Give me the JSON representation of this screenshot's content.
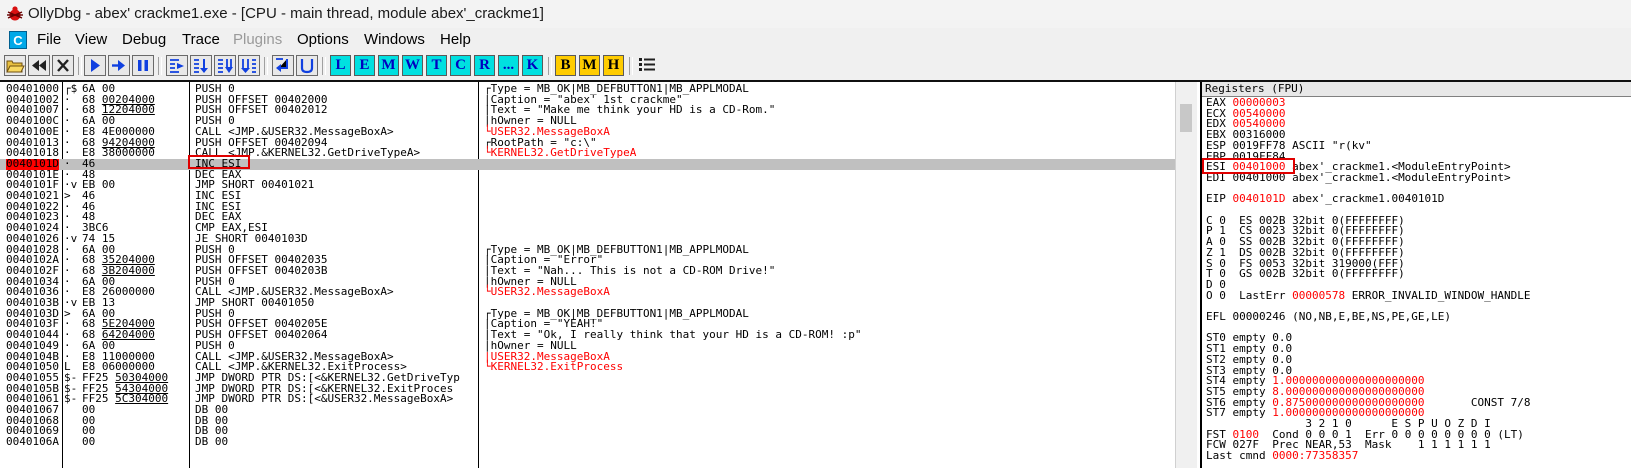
{
  "window": {
    "title": "OllyDbg - abex' crackme1.exe - [CPU - main thread, module abex'_crackme1]",
    "icon": "ollydbg-bug-icon"
  },
  "menu": {
    "logo": "C",
    "items": [
      "File",
      "View",
      "Debug",
      "Trace",
      "Plugins",
      "Options",
      "Windows",
      "Help"
    ]
  },
  "toolbar": {
    "letters": [
      "L",
      "E",
      "M",
      "W",
      "T",
      "C",
      "R",
      "...",
      "K",
      "B",
      "M",
      "H"
    ]
  },
  "code": {
    "rows": [
      {
        "addr": "00401000",
        "mark": "┌$",
        "hex": "6A 00",
        "hexu": "",
        "asm": "PUSH 0",
        "cmt": "┌Type = MB_OK|MB_DEFBUTTON1|MB_APPLMODAL",
        "cc": "black"
      },
      {
        "addr": "00401002",
        "mark": "·",
        "hex": "68 ",
        "hexu": "00204000",
        "asm": "PUSH OFFSET 00402000",
        "cmt": "|Caption = \"abex' 1st crackme\"",
        "cc": "black"
      },
      {
        "addr": "00401007",
        "mark": "·",
        "hex": "68 ",
        "hexu": "12204000",
        "asm": "PUSH OFFSET 00402012",
        "cmt": "|Text = \"Make me think your HD is a CD-Rom.\"",
        "cc": "black"
      },
      {
        "addr": "0040100C",
        "mark": "·",
        "hex": "6A 00",
        "hexu": "",
        "asm": "PUSH 0",
        "cmt": "|hOwner = NULL",
        "cc": "black"
      },
      {
        "addr": "0040100E",
        "mark": "·",
        "hex": "E8 4E000000",
        "hexu": "",
        "asm": "CALL <JMP.&USER32.MessageBoxA>",
        "cmt": "└USER32.MessageBoxA",
        "cc": "red"
      },
      {
        "addr": "00401013",
        "mark": "·",
        "hex": "68 ",
        "hexu": "94204000",
        "asm": "PUSH OFFSET 00402094",
        "cmt": "┌RootPath = \"c:\\\"",
        "cc": "black"
      },
      {
        "addr": "00401018",
        "mark": "·",
        "hex": "E8 38000000",
        "hexu": "",
        "asm": "CALL <JMP.&KERNEL32.GetDriveTypeA>",
        "cmt": "└KERNEL32.GetDriveTypeA",
        "cc": "red"
      },
      {
        "addr": "0040101D",
        "mark": "·",
        "hex": "46",
        "hexu": "",
        "asm": "INC ESI",
        "cmt": "",
        "cc": "black",
        "sel": true
      },
      {
        "addr": "0040101E",
        "mark": "·",
        "hex": "48",
        "hexu": "",
        "asm": "DEC EAX",
        "cmt": "",
        "cc": "black"
      },
      {
        "addr": "0040101F",
        "mark": "·v",
        "hex": "EB 00",
        "hexu": "",
        "asm": "JMP SHORT 00401021",
        "cmt": "",
        "cc": "black"
      },
      {
        "addr": "00401021",
        "mark": ">",
        "hex": "46",
        "hexu": "",
        "asm": "INC ESI",
        "cmt": "",
        "cc": "black"
      },
      {
        "addr": "00401022",
        "mark": "·",
        "hex": "46",
        "hexu": "",
        "asm": "INC ESI",
        "cmt": "",
        "cc": "black"
      },
      {
        "addr": "00401023",
        "mark": "·",
        "hex": "48",
        "hexu": "",
        "asm": "DEC EAX",
        "cmt": "",
        "cc": "black"
      },
      {
        "addr": "00401024",
        "mark": "·",
        "hex": "3BC6",
        "hexu": "",
        "asm": "CMP EAX,ESI",
        "cmt": "",
        "cc": "black"
      },
      {
        "addr": "00401026",
        "mark": "·v",
        "hex": "74 15",
        "hexu": "",
        "asm": "JE SHORT 0040103D",
        "cmt": "",
        "cc": "black"
      },
      {
        "addr": "00401028",
        "mark": "·",
        "hex": "6A 00",
        "hexu": "",
        "asm": "PUSH 0",
        "cmt": "┌Type = MB_OK|MB_DEFBUTTON1|MB_APPLMODAL",
        "cc": "black"
      },
      {
        "addr": "0040102A",
        "mark": "·",
        "hex": "68 ",
        "hexu": "35204000",
        "asm": "PUSH OFFSET 00402035",
        "cmt": "|Caption = \"Error\"",
        "cc": "black"
      },
      {
        "addr": "0040102F",
        "mark": "·",
        "hex": "68 ",
        "hexu": "3B204000",
        "asm": "PUSH OFFSET 0040203B",
        "cmt": "|Text = \"Nah... This is not a CD-ROM Drive!\"",
        "cc": "black"
      },
      {
        "addr": "00401034",
        "mark": "·",
        "hex": "6A 00",
        "hexu": "",
        "asm": "PUSH 0",
        "cmt": "|hOwner = NULL",
        "cc": "black"
      },
      {
        "addr": "00401036",
        "mark": "·",
        "hex": "E8 26000000",
        "hexu": "",
        "asm": "CALL <JMP.&USER32.MessageBoxA>",
        "cmt": "└USER32.MessageBoxA",
        "cc": "red"
      },
      {
        "addr": "0040103B",
        "mark": "·v",
        "hex": "EB 13",
        "hexu": "",
        "asm": "JMP SHORT 00401050",
        "cmt": "",
        "cc": "black"
      },
      {
        "addr": "0040103D",
        "mark": ">",
        "hex": "6A 00",
        "hexu": "",
        "asm": "PUSH 0",
        "cmt": "┌Type = MB_OK|MB_DEFBUTTON1|MB_APPLMODAL",
        "cc": "black"
      },
      {
        "addr": "0040103F",
        "mark": "·",
        "hex": "68 ",
        "hexu": "5E204000",
        "asm": "PUSH OFFSET 0040205E",
        "cmt": "|Caption = \"YEAH!\"",
        "cc": "black"
      },
      {
        "addr": "00401044",
        "mark": "·",
        "hex": "68 ",
        "hexu": "64204000",
        "asm": "PUSH OFFSET 00402064",
        "cmt": "|Text = \"Ok, I really think that your HD is a CD-ROM! :p\"",
        "cc": "black"
      },
      {
        "addr": "00401049",
        "mark": "·",
        "hex": "6A 00",
        "hexu": "",
        "asm": "PUSH 0",
        "cmt": "|hOwner = NULL",
        "cc": "black"
      },
      {
        "addr": "0040104B",
        "mark": "·",
        "hex": "E8 11000000",
        "hexu": "",
        "asm": "CALL <JMP.&USER32.MessageBoxA>",
        "cmt": "|USER32.MessageBoxA",
        "cc": "red"
      },
      {
        "addr": "00401050",
        "mark": "L",
        "hex": "E8 06000000",
        "hexu": "",
        "asm": "CALL <JMP.&KERNEL32.ExitProcess>",
        "cmt": "└KERNEL32.ExitProcess",
        "cc": "red"
      },
      {
        "addr": "00401055",
        "mark": "$-",
        "hex": "FF25 ",
        "hexu": "50304000",
        "asm": "JMP DWORD PTR DS:[<&KERNEL32.GetDriveTyp",
        "cmt": "",
        "cc": "black"
      },
      {
        "addr": "0040105B",
        "mark": "$-",
        "hex": "FF25 ",
        "hexu": "54304000",
        "asm": "JMP DWORD PTR DS:[<&KERNEL32.ExitProces",
        "cmt": "",
        "cc": "black"
      },
      {
        "addr": "00401061",
        "mark": "$-",
        "hex": "FF25 ",
        "hexu": "5C304000",
        "asm": "JMP DWORD PTR DS:[<&USER32.MessageBoxA>",
        "cmt": "",
        "cc": "black"
      },
      {
        "addr": "00401067",
        "mark": "",
        "hex": "00",
        "hexu": "",
        "asm": "DB 00",
        "cmt": "",
        "cc": "black"
      },
      {
        "addr": "00401068",
        "mark": "",
        "hex": "00",
        "hexu": "",
        "asm": "DB 00",
        "cmt": "",
        "cc": "black"
      },
      {
        "addr": "00401069",
        "mark": "",
        "hex": "00",
        "hexu": "",
        "asm": "DB 00",
        "cmt": "",
        "cc": "black"
      },
      {
        "addr": "0040106A",
        "mark": "",
        "hex": "00",
        "hexu": "",
        "asm": "DB 00",
        "cmt": "",
        "cc": "black"
      }
    ]
  },
  "registers": {
    "header": "Registers (FPU)",
    "lines": [
      {
        "name": "EAX ",
        "val": "00000003",
        "rest": ""
      },
      {
        "name": "ECX ",
        "val": "00540000",
        "rest": ""
      },
      {
        "name": "EDX ",
        "val": "00540000",
        "rest": ""
      },
      {
        "name": "EBX ",
        "val": "",
        "rest": "00316000"
      },
      {
        "name": "ESP ",
        "val": "",
        "rest": "0019FF78 ASCII \"r(kv\""
      },
      {
        "name": "EBP ",
        "val": "",
        "rest": "0019FF84"
      },
      {
        "name": "ESI ",
        "val": "00401000",
        "rest": " abex'_crackme1.<ModuleEntryPoint>"
      },
      {
        "name": "EDI ",
        "val": "",
        "rest": "00401000 abex'_crackme1.<ModuleEntryPoint>"
      },
      {
        "name": "",
        "val": "",
        "rest": ""
      },
      {
        "name": "EIP ",
        "val": "0040101D",
        "rest": " abex'_crackme1.0040101D"
      },
      {
        "name": "",
        "val": "",
        "rest": ""
      },
      {
        "name": "C 0  ",
        "val": "",
        "rest": "ES 002B 32bit 0(FFFFFFFF)"
      },
      {
        "name": "P 1  ",
        "val": "",
        "rest": "CS 0023 32bit 0(FFFFFFFF)"
      },
      {
        "name": "A 0  ",
        "val": "",
        "rest": "SS 002B 32bit 0(FFFFFFFF)"
      },
      {
        "name": "Z 1  ",
        "val": "",
        "rest": "DS 002B 32bit 0(FFFFFFFF)"
      },
      {
        "name": "S 0  ",
        "val": "",
        "rest": "FS 0053 32bit 319000(FFF)"
      },
      {
        "name": "T 0  ",
        "val": "",
        "rest": "GS 002B 32bit 0(FFFFFFFF)"
      },
      {
        "name": "D 0",
        "val": "",
        "rest": ""
      },
      {
        "name": "O 0  LastErr ",
        "val": "00000578",
        "rest": " ERROR_INVALID_WINDOW_HANDLE"
      },
      {
        "name": "",
        "val": "",
        "rest": ""
      },
      {
        "name": "EFL ",
        "val": "",
        "rest": "00000246 (NO,NB,E,BE,NS,PE,GE,LE)"
      },
      {
        "name": "",
        "val": "",
        "rest": ""
      },
      {
        "name": "ST0 empty ",
        "val": "",
        "rest": "0.0"
      },
      {
        "name": "ST1 empty ",
        "val": "",
        "rest": "0.0"
      },
      {
        "name": "ST2 empty ",
        "val": "",
        "rest": "0.0"
      },
      {
        "name": "ST3 empty ",
        "val": "",
        "rest": "0.0"
      },
      {
        "name": "ST4 empty ",
        "val": "1.000000000000000000000",
        "rest": ""
      },
      {
        "name": "ST5 empty ",
        "val": "8.000000000000000000000",
        "rest": ""
      },
      {
        "name": "ST6 empty ",
        "val": "0.875000000000000000000",
        "rest": "       CONST 7/8"
      },
      {
        "name": "ST7 empty ",
        "val": "1.000000000000000000000",
        "rest": ""
      },
      {
        "name": "",
        "val": "",
        "rest": "               3 2 1 0      E S P U O Z D I"
      },
      {
        "name": "FST ",
        "val": "0100",
        "rest": "  Cond 0 0 0 1  Err 0 0 0 0 0 0 0 0 (LT)"
      },
      {
        "name": "FCW ",
        "val": "",
        "rest": "027F  Prec NEAR,53  Mask    1 1 1 1 1 1"
      },
      {
        "name": "Last cmnd ",
        "val": "0000:77358357",
        "rest": ""
      }
    ]
  }
}
